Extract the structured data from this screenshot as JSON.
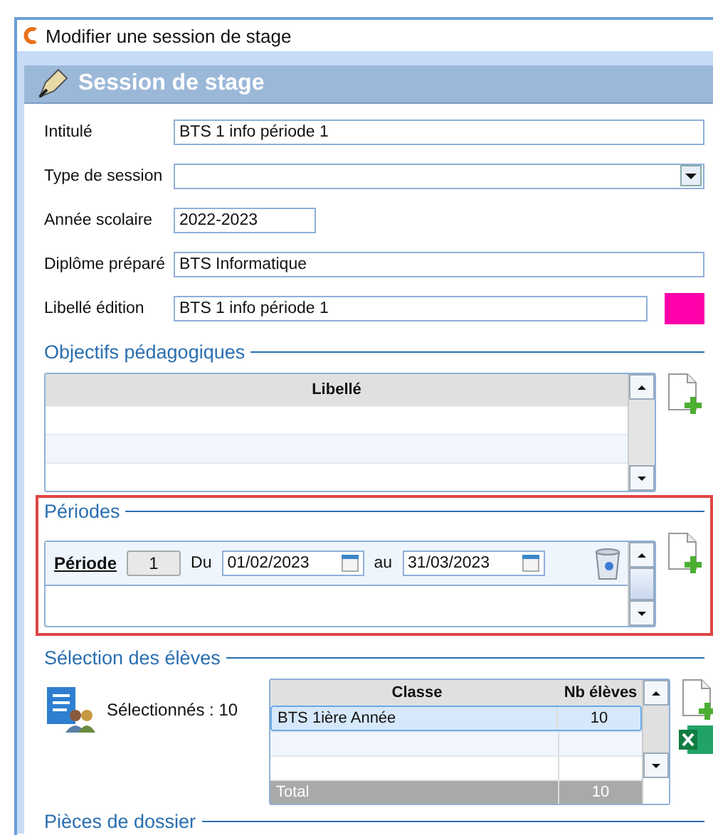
{
  "window": {
    "title": "Modifier une session de stage"
  },
  "panel": {
    "title": "Session de stage"
  },
  "fields": [
    {
      "label": "Intitulé",
      "value": "BTS 1 info période 1",
      "kind": "text"
    },
    {
      "label": "Type de session",
      "kind": "dropdown"
    },
    {
      "label": "Année scolaire",
      "value": "2022-2023",
      "kind": "short"
    },
    {
      "label": "Diplôme préparé",
      "value": "BTS Informatique",
      "kind": "text"
    },
    {
      "label": "Libellé édition",
      "value": "BTS 1 info période 1",
      "kind": "color",
      "color": "#ff00aa"
    }
  ],
  "objectives": {
    "title": "Objectifs pédagogiques",
    "columns": [
      "Libellé"
    ]
  },
  "periods": {
    "title": "Périodes",
    "highlighted": true,
    "items": [
      {
        "label": "Période",
        "number": "1",
        "from_label": "Du",
        "from": "01/02/2023",
        "to_label": "au",
        "to": "31/03/2023"
      }
    ]
  },
  "students": {
    "title": "Sélection des élèves",
    "selected_label": "Sélectionnés : 10",
    "columns": [
      "Classe",
      "Nb élèves"
    ],
    "rows": [
      {
        "cells": [
          "BTS 1ière Année",
          "10"
        ],
        "selected": true
      }
    ],
    "total": [
      "Total",
      "10"
    ]
  },
  "next_section": {
    "title": "Pièces de dossier"
  }
}
